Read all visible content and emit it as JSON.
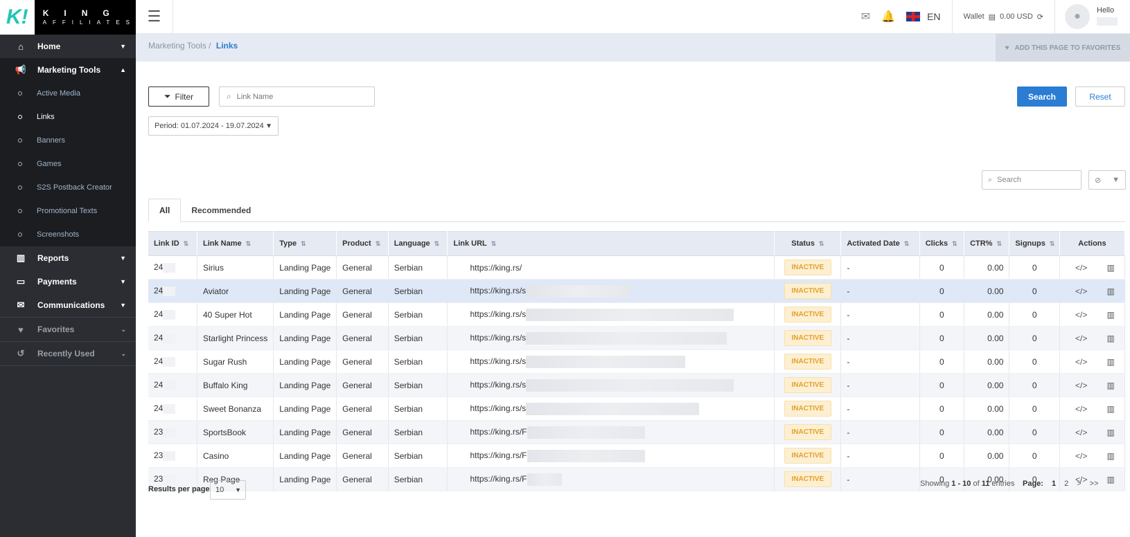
{
  "brand": {
    "mark": "K!",
    "line1": "KING",
    "line2": "AFFILIATES"
  },
  "sidebar": {
    "items": [
      {
        "label": "Home"
      },
      {
        "label": "Marketing Tools"
      },
      {
        "label": "Reports"
      },
      {
        "label": "Payments"
      },
      {
        "label": "Communications"
      },
      {
        "label": "Favorites"
      },
      {
        "label": "Recently Used"
      }
    ],
    "sub_items": [
      {
        "label": "Active Media"
      },
      {
        "label": "Links"
      },
      {
        "label": "Banners"
      },
      {
        "label": "Games"
      },
      {
        "label": "S2S Postback Creator"
      },
      {
        "label": "Promotional Texts"
      },
      {
        "label": "Screenshots"
      }
    ]
  },
  "header": {
    "lang": "EN",
    "wallet_label": "Wallet",
    "wallet_value": "0.00 USD",
    "hello": "Hello"
  },
  "breadcrumb": {
    "parent": "Marketing Tools",
    "sep": "/",
    "current": "Links",
    "favorite_button": "ADD THIS PAGE TO FAVORITES"
  },
  "filters": {
    "filter_button": "Filter",
    "link_name_placeholder": "Link Name",
    "search_button": "Search",
    "reset_button": "Reset",
    "period": "Period: 01.07.2024 - 19.07.2024",
    "table_search_placeholder": "Search"
  },
  "tabs": [
    {
      "label": "All"
    },
    {
      "label": "Recommended"
    }
  ],
  "table": {
    "columns": [
      "Link ID",
      "Link Name",
      "Type",
      "Product",
      "Language",
      "Link URL",
      "Status",
      "Activated Date",
      "Clicks",
      "CTR%",
      "Signups",
      "Actions"
    ],
    "rows": [
      {
        "id": "24",
        "name": "Sirius",
        "type": "Landing Page",
        "product": "General",
        "language": "Serbian",
        "url": "https://king.rs/",
        "status": "INACTIVE",
        "activated": "-",
        "clicks": "0",
        "ctr": "0.00",
        "signups": "0"
      },
      {
        "id": "24",
        "name": "Aviator",
        "type": "Landing Page",
        "product": "General",
        "language": "Serbian",
        "url": "https://king.rs/s",
        "status": "INACTIVE",
        "activated": "-",
        "clicks": "0",
        "ctr": "0.00",
        "signups": "0"
      },
      {
        "id": "24",
        "name": "40 Super Hot",
        "type": "Landing Page",
        "product": "General",
        "language": "Serbian",
        "url": "https://king.rs/s",
        "status": "INACTIVE",
        "activated": "-",
        "clicks": "0",
        "ctr": "0.00",
        "signups": "0"
      },
      {
        "id": "24",
        "name": "Starlight Princess",
        "type": "Landing Page",
        "product": "General",
        "language": "Serbian",
        "url": "https://king.rs/s",
        "status": "INACTIVE",
        "activated": "-",
        "clicks": "0",
        "ctr": "0.00",
        "signups": "0"
      },
      {
        "id": "24",
        "name": "Sugar Rush",
        "type": "Landing Page",
        "product": "General",
        "language": "Serbian",
        "url": "https://king.rs/s",
        "status": "INACTIVE",
        "activated": "-",
        "clicks": "0",
        "ctr": "0.00",
        "signups": "0"
      },
      {
        "id": "24",
        "name": "Buffalo King",
        "type": "Landing Page",
        "product": "General",
        "language": "Serbian",
        "url": "https://king.rs/s",
        "status": "INACTIVE",
        "activated": "-",
        "clicks": "0",
        "ctr": "0.00",
        "signups": "0"
      },
      {
        "id": "24",
        "name": "Sweet Bonanza",
        "type": "Landing Page",
        "product": "General",
        "language": "Serbian",
        "url": "https://king.rs/s",
        "status": "INACTIVE",
        "activated": "-",
        "clicks": "0",
        "ctr": "0.00",
        "signups": "0"
      },
      {
        "id": "23",
        "name": "SportsBook",
        "type": "Landing Page",
        "product": "General",
        "language": "Serbian",
        "url": "https://king.rs/F",
        "status": "INACTIVE",
        "activated": "-",
        "clicks": "0",
        "ctr": "0.00",
        "signups": "0"
      },
      {
        "id": "23",
        "name": "Casino",
        "type": "Landing Page",
        "product": "General",
        "language": "Serbian",
        "url": "https://king.rs/F",
        "status": "INACTIVE",
        "activated": "-",
        "clicks": "0",
        "ctr": "0.00",
        "signups": "0"
      },
      {
        "id": "23",
        "name": "Reg Page",
        "type": "Landing Page",
        "product": "General",
        "language": "Serbian",
        "url": "https://king.rs/F",
        "status": "INACTIVE",
        "activated": "-",
        "clicks": "0",
        "ctr": "0.00",
        "signups": "0"
      }
    ]
  },
  "footer": {
    "results_label": "Results per page",
    "per_page": "10",
    "showing_prefix": "Showing",
    "range": "1 - 10",
    "of": "of",
    "total": "11",
    "entries": "entries",
    "page_label": "Page:",
    "pages": [
      "1",
      "2"
    ],
    "next": ">",
    "last": ">>"
  },
  "colors": {
    "sidebar_bg": "#2b2d33",
    "accent": "#2b7cd3",
    "brand_teal": "#1fc7b3",
    "inactive_badge": "#e3a12a"
  }
}
